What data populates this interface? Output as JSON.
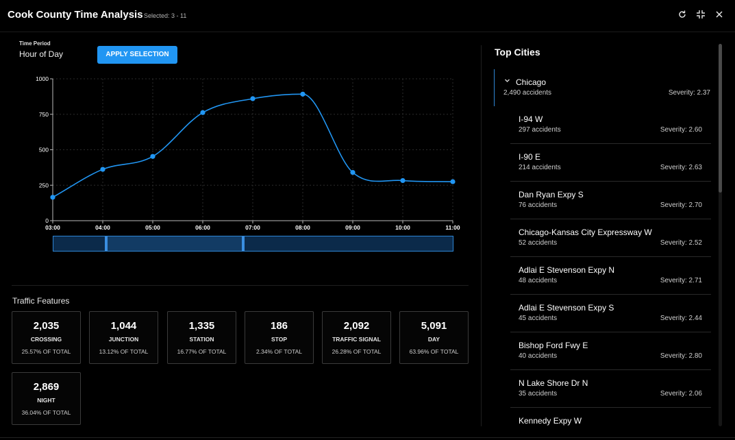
{
  "header": {
    "title": "Cook County Time Analysis",
    "selected": "Selected: 3 - 11",
    "icons": [
      "refresh-icon",
      "collapse-icon",
      "close-icon"
    ]
  },
  "time_period": {
    "label": "Time Period",
    "value": "Hour of Day",
    "apply_label": "APPLY SELECTION"
  },
  "chart_data": {
    "type": "line",
    "x": [
      "03:00",
      "04:00",
      "05:00",
      "06:00",
      "07:00",
      "08:00",
      "09:00",
      "10:00",
      "11:00"
    ],
    "values": [
      165,
      362,
      453,
      762,
      860,
      892,
      340,
      283,
      275
    ],
    "yticks": [
      0,
      250,
      500,
      750,
      1000
    ],
    "ylim": [
      0,
      1000
    ],
    "grid": true,
    "color": "#2196f3"
  },
  "brush": {
    "range_start": 3,
    "range_end": 11,
    "handle_positions": [
      4.05,
      6.8
    ]
  },
  "traffic_features": {
    "title": "Traffic Features",
    "cards": [
      {
        "value": "2,035",
        "label": "CROSSING",
        "pct": "25.57% OF TOTAL"
      },
      {
        "value": "1,044",
        "label": "JUNCTION",
        "pct": "13.12% OF TOTAL"
      },
      {
        "value": "1,335",
        "label": "STATION",
        "pct": "16.77% OF TOTAL"
      },
      {
        "value": "186",
        "label": "STOP",
        "pct": "2.34% OF TOTAL"
      },
      {
        "value": "2,092",
        "label": "TRAFFIC SIGNAL",
        "pct": "26.28% OF TOTAL"
      },
      {
        "value": "5,091",
        "label": "DAY",
        "pct": "63.96% OF TOTAL"
      },
      {
        "value": "2,869",
        "label": "NIGHT",
        "pct": "36.04% OF TOTAL"
      }
    ]
  },
  "top_cities": {
    "title": "Top Cities",
    "city": {
      "name": "Chicago",
      "count": "2,490 accidents",
      "severity": "Severity: 2.37"
    },
    "roads": [
      {
        "name": "I-94 W",
        "count": "297 accidents",
        "severity": "Severity: 2.60"
      },
      {
        "name": "I-90 E",
        "count": "214 accidents",
        "severity": "Severity: 2.63"
      },
      {
        "name": "Dan Ryan Expy S",
        "count": "76 accidents",
        "severity": "Severity: 2.70"
      },
      {
        "name": "Chicago-Kansas City Expressway W",
        "count": "52 accidents",
        "severity": "Severity: 2.52"
      },
      {
        "name": "Adlai E Stevenson Expy N",
        "count": "48 accidents",
        "severity": "Severity: 2.71"
      },
      {
        "name": "Adlai E Stevenson Expy S",
        "count": "45 accidents",
        "severity": "Severity: 2.44"
      },
      {
        "name": "Bishop Ford Fwy E",
        "count": "40 accidents",
        "severity": "Severity: 2.80"
      },
      {
        "name": "N Lake Shore Dr N",
        "count": "35 accidents",
        "severity": "Severity: 2.06"
      },
      {
        "name": "Kennedy Expy W",
        "count": "",
        "severity": ""
      }
    ]
  }
}
